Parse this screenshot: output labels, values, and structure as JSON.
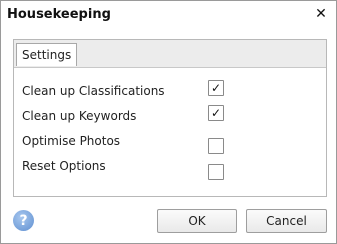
{
  "dialog": {
    "title": "Housekeeping",
    "close_icon": "close-icon"
  },
  "tabs": [
    {
      "label": "Settings",
      "active": true
    }
  ],
  "options": [
    {
      "label": "Clean up Classifications",
      "checked": true
    },
    {
      "label": "Clean up Keywords",
      "checked": true
    },
    {
      "label": "Optimise Photos",
      "checked": false
    },
    {
      "label": "Reset Options",
      "checked": false
    }
  ],
  "footer": {
    "help_icon": "help-icon",
    "ok_label": "OK",
    "cancel_label": "Cancel"
  },
  "colors": {
    "help_icon": "#6b98d6"
  }
}
